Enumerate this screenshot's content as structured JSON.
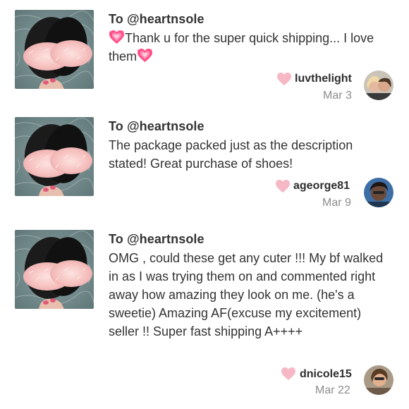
{
  "reviews": [
    {
      "to": "To @heartnsole",
      "text": "Thank u for the super quick shipping... I love them",
      "username": "luvthelight",
      "date": "Mar 3"
    },
    {
      "to": "To @heartnsole",
      "text": "The package packed just as the description stated! Great purchase of shoes!",
      "username": "ageorge81",
      "date": "Mar 9"
    },
    {
      "to": "To @heartnsole",
      "text": "OMG , could these get any cuter !!! My bf walked in as I was trying them on and commented right away how amazing they look on me. (he's a sweetie) Amazing AF(excuse my excitement) seller !! Super fast shipping A++++",
      "username": "dnicole15",
      "date": "Mar 22"
    }
  ],
  "colors": {
    "like_heart": "#f7b8c6",
    "emoji_heart": "#ff5a8c",
    "username": "#2e2e2e",
    "date": "#8c8c8c"
  },
  "icons": {
    "like": "heart-icon",
    "emoji": "growing-heart-emoji"
  }
}
